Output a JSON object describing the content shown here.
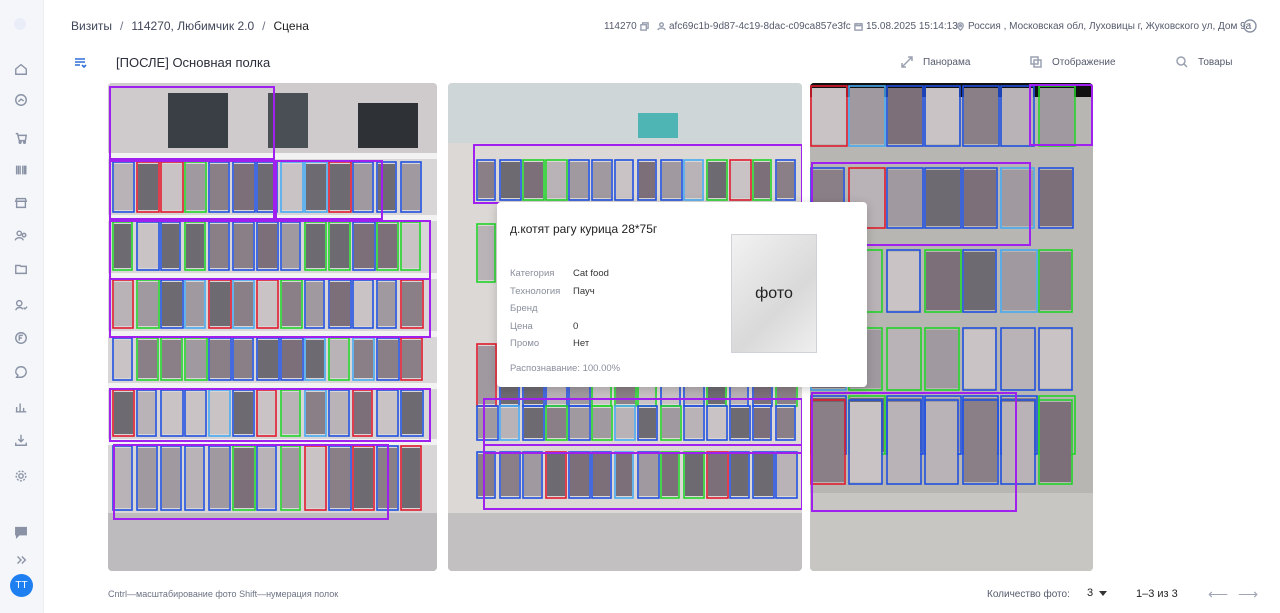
{
  "breadcrumb": {
    "items": [
      "Визиты",
      "114270, Любимчик 2.0",
      "Сцена"
    ],
    "separator": "/"
  },
  "meta": {
    "visit_id": "114270",
    "uuid": "afc69c1b-9d87-4c19-8dac-c09ca857e3fc",
    "datetime": "15.08.2025 15:14:13",
    "address": "Россия , Московская обл, Луховицы г, Жуковского ул, Дом 9а"
  },
  "scene": {
    "title": "[ПОСЛЕ] Основная полка"
  },
  "tools": {
    "panorama": "Панорама",
    "display": "Отображение",
    "products": "Товары"
  },
  "tooltip": {
    "title": "д.котят рагу курица 28*75г",
    "rows": [
      {
        "label": "Категория",
        "value": "Cat food"
      },
      {
        "label": "Технология",
        "value": "Пауч"
      },
      {
        "label": "Бренд",
        "value": ""
      },
      {
        "label": "Цена",
        "value": "0"
      },
      {
        "label": "Промо",
        "value": "Нет"
      }
    ],
    "recognition": "Распознавание: 100.00%",
    "photo_placeholder": "фото"
  },
  "footer": {
    "hint": "Cntrl—масштабирование фото Shift—нумерация полок",
    "count_label": "Количество фото:",
    "count_value": "3",
    "pager": "1–3 из  3"
  },
  "user": {
    "initials": "TT"
  },
  "colors": {
    "accent": "#1e7ff0",
    "box_blue": "#1f4fe0",
    "box_green": "#22d32a",
    "box_red": "#e01b2e",
    "box_purple": "#a020f0",
    "box_lightblue": "#46a9f0"
  },
  "icons": {
    "sidebar": [
      "home-icon",
      "analytics-icon",
      "cart-icon",
      "barcode-icon",
      "store-icon",
      "users-icon",
      "folder-icon",
      "tasks-icon",
      "document-icon",
      "chat-icon",
      "chart-icon",
      "download-icon",
      "settings-icon",
      "messages-icon",
      "expand-icon"
    ]
  }
}
